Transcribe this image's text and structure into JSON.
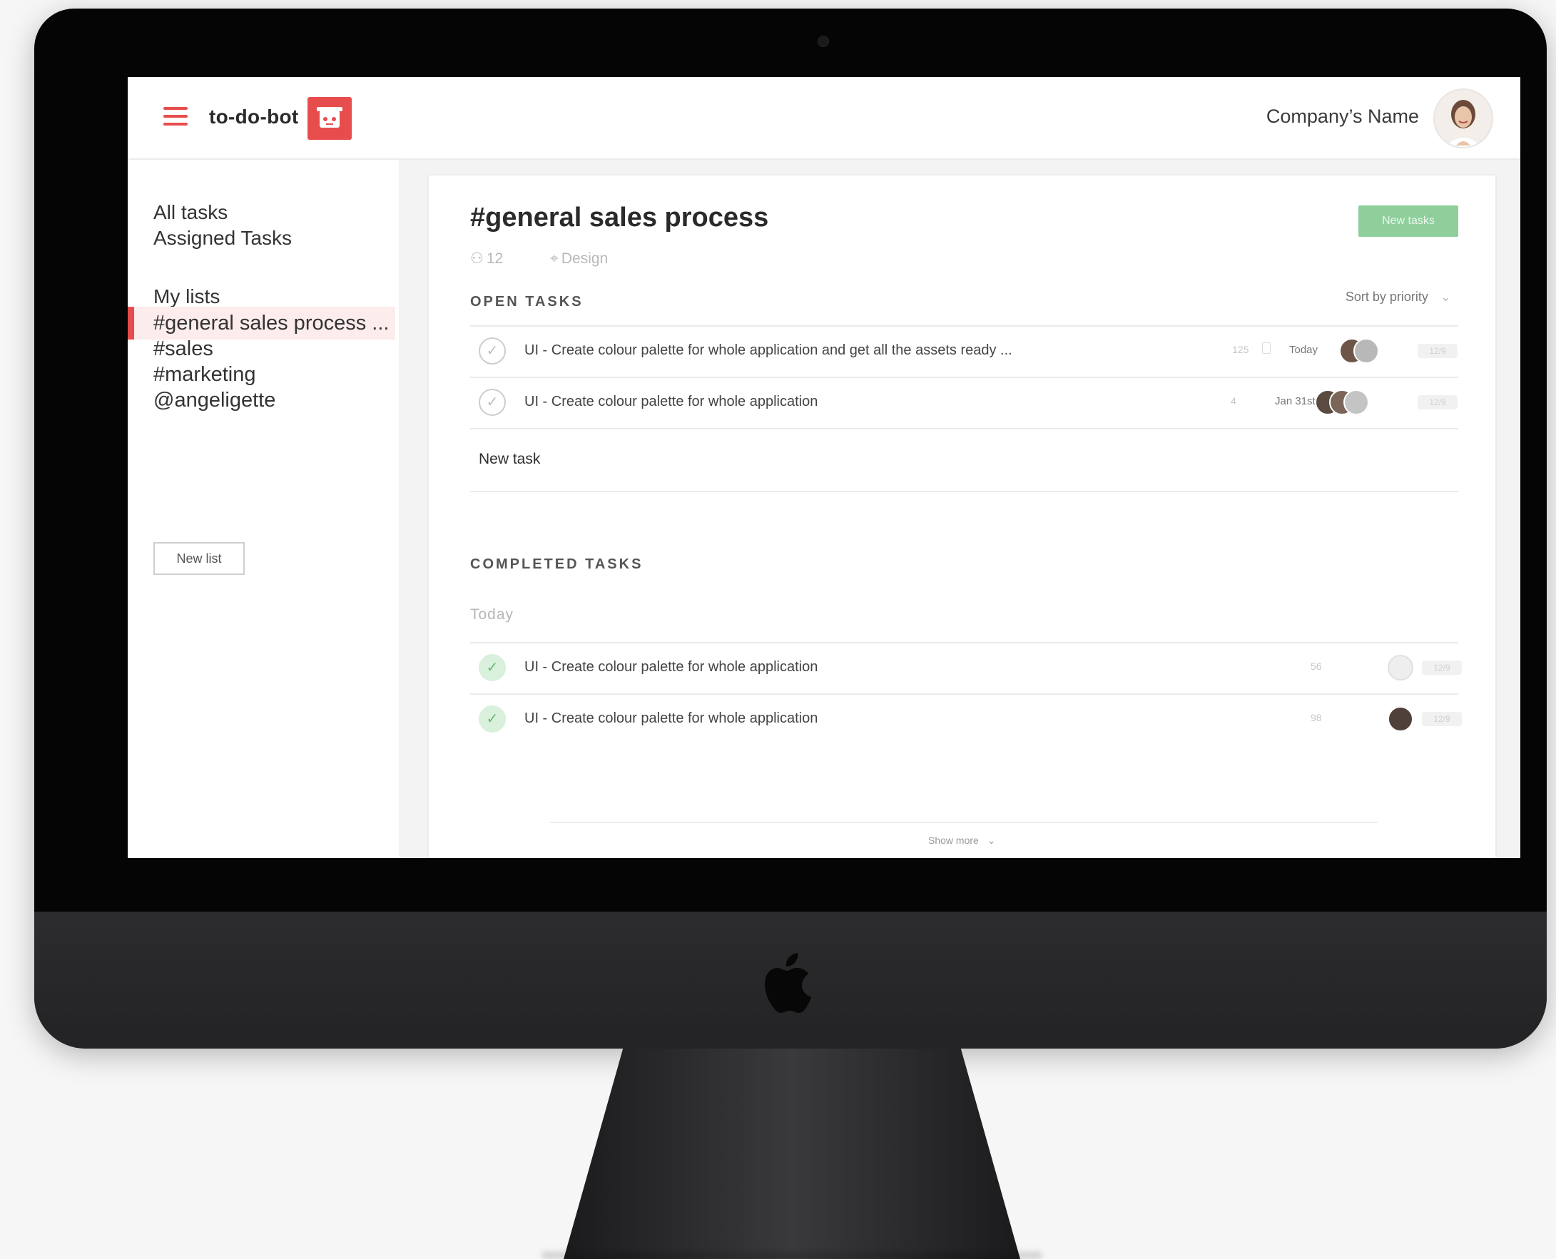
{
  "app": {
    "name": "to-do-bot",
    "company": "Company’s Name",
    "accent": "#e84d4d",
    "success": "#8fcf9c"
  },
  "icons": {
    "menu": "hamburger-icon",
    "brand": "bot-logo-icon",
    "user": "user-avatar",
    "members": "person-icon",
    "tag": "tag-icon",
    "check": "checkmark-icon",
    "device": "apple-logo-icon"
  },
  "sidebar": {
    "nav": [
      "All tasks",
      "Assigned Tasks"
    ],
    "lists_heading": "My lists",
    "lists": [
      "#general sales process ...",
      "#sales",
      "#marketing",
      "@angeligette"
    ],
    "active_list": 0,
    "new_list_label": "New list"
  },
  "main": {
    "title": "#general sales process",
    "members": "12",
    "tag": "Design",
    "new_tasks_label": "New tasks",
    "open_heading": "OPEN TASKS",
    "sort_label": "Sort by priority",
    "open_tasks": [
      {
        "text": "UI - Create colour palette for whole application and get all the assets ready ...",
        "count": "125",
        "date": "Today",
        "pill": "12/9"
      },
      {
        "text": "UI - Create colour palette for whole application",
        "count": "4",
        "date": "Jan 31st",
        "pill": "12/9"
      }
    ],
    "new_task_label": "New task",
    "completed_heading": "COMPLETED TASKS",
    "completed_group": "Today",
    "completed_tasks": [
      {
        "text": "UI - Create colour palette for whole application",
        "count": "56",
        "pill": "12/9"
      },
      {
        "text": "UI - Create colour palette for whole application",
        "count": "98",
        "pill": "12/9"
      }
    ],
    "show_more_label": "Show more"
  }
}
